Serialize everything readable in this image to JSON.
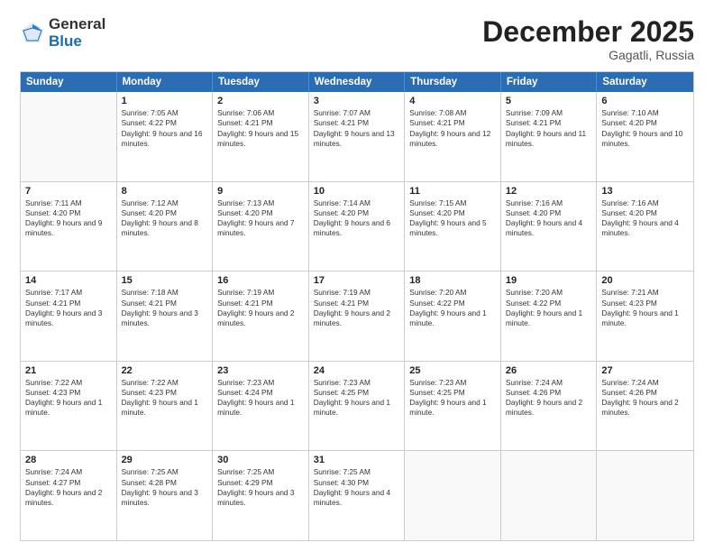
{
  "logo": {
    "general": "General",
    "blue": "Blue"
  },
  "title": "December 2025",
  "location": "Gagatli, Russia",
  "header_days": [
    "Sunday",
    "Monday",
    "Tuesday",
    "Wednesday",
    "Thursday",
    "Friday",
    "Saturday"
  ],
  "weeks": [
    [
      {
        "day": "",
        "sunrise": "",
        "sunset": "",
        "daylight": ""
      },
      {
        "day": "1",
        "sunrise": "Sunrise: 7:05 AM",
        "sunset": "Sunset: 4:22 PM",
        "daylight": "Daylight: 9 hours and 16 minutes."
      },
      {
        "day": "2",
        "sunrise": "Sunrise: 7:06 AM",
        "sunset": "Sunset: 4:21 PM",
        "daylight": "Daylight: 9 hours and 15 minutes."
      },
      {
        "day": "3",
        "sunrise": "Sunrise: 7:07 AM",
        "sunset": "Sunset: 4:21 PM",
        "daylight": "Daylight: 9 hours and 13 minutes."
      },
      {
        "day": "4",
        "sunrise": "Sunrise: 7:08 AM",
        "sunset": "Sunset: 4:21 PM",
        "daylight": "Daylight: 9 hours and 12 minutes."
      },
      {
        "day": "5",
        "sunrise": "Sunrise: 7:09 AM",
        "sunset": "Sunset: 4:21 PM",
        "daylight": "Daylight: 9 hours and 11 minutes."
      },
      {
        "day": "6",
        "sunrise": "Sunrise: 7:10 AM",
        "sunset": "Sunset: 4:20 PM",
        "daylight": "Daylight: 9 hours and 10 minutes."
      }
    ],
    [
      {
        "day": "7",
        "sunrise": "Sunrise: 7:11 AM",
        "sunset": "Sunset: 4:20 PM",
        "daylight": "Daylight: 9 hours and 9 minutes."
      },
      {
        "day": "8",
        "sunrise": "Sunrise: 7:12 AM",
        "sunset": "Sunset: 4:20 PM",
        "daylight": "Daylight: 9 hours and 8 minutes."
      },
      {
        "day": "9",
        "sunrise": "Sunrise: 7:13 AM",
        "sunset": "Sunset: 4:20 PM",
        "daylight": "Daylight: 9 hours and 7 minutes."
      },
      {
        "day": "10",
        "sunrise": "Sunrise: 7:14 AM",
        "sunset": "Sunset: 4:20 PM",
        "daylight": "Daylight: 9 hours and 6 minutes."
      },
      {
        "day": "11",
        "sunrise": "Sunrise: 7:15 AM",
        "sunset": "Sunset: 4:20 PM",
        "daylight": "Daylight: 9 hours and 5 minutes."
      },
      {
        "day": "12",
        "sunrise": "Sunrise: 7:16 AM",
        "sunset": "Sunset: 4:20 PM",
        "daylight": "Daylight: 9 hours and 4 minutes."
      },
      {
        "day": "13",
        "sunrise": "Sunrise: 7:16 AM",
        "sunset": "Sunset: 4:20 PM",
        "daylight": "Daylight: 9 hours and 4 minutes."
      }
    ],
    [
      {
        "day": "14",
        "sunrise": "Sunrise: 7:17 AM",
        "sunset": "Sunset: 4:21 PM",
        "daylight": "Daylight: 9 hours and 3 minutes."
      },
      {
        "day": "15",
        "sunrise": "Sunrise: 7:18 AM",
        "sunset": "Sunset: 4:21 PM",
        "daylight": "Daylight: 9 hours and 3 minutes."
      },
      {
        "day": "16",
        "sunrise": "Sunrise: 7:19 AM",
        "sunset": "Sunset: 4:21 PM",
        "daylight": "Daylight: 9 hours and 2 minutes."
      },
      {
        "day": "17",
        "sunrise": "Sunrise: 7:19 AM",
        "sunset": "Sunset: 4:21 PM",
        "daylight": "Daylight: 9 hours and 2 minutes."
      },
      {
        "day": "18",
        "sunrise": "Sunrise: 7:20 AM",
        "sunset": "Sunset: 4:22 PM",
        "daylight": "Daylight: 9 hours and 1 minute."
      },
      {
        "day": "19",
        "sunrise": "Sunrise: 7:20 AM",
        "sunset": "Sunset: 4:22 PM",
        "daylight": "Daylight: 9 hours and 1 minute."
      },
      {
        "day": "20",
        "sunrise": "Sunrise: 7:21 AM",
        "sunset": "Sunset: 4:23 PM",
        "daylight": "Daylight: 9 hours and 1 minute."
      }
    ],
    [
      {
        "day": "21",
        "sunrise": "Sunrise: 7:22 AM",
        "sunset": "Sunset: 4:23 PM",
        "daylight": "Daylight: 9 hours and 1 minute."
      },
      {
        "day": "22",
        "sunrise": "Sunrise: 7:22 AM",
        "sunset": "Sunset: 4:23 PM",
        "daylight": "Daylight: 9 hours and 1 minute."
      },
      {
        "day": "23",
        "sunrise": "Sunrise: 7:23 AM",
        "sunset": "Sunset: 4:24 PM",
        "daylight": "Daylight: 9 hours and 1 minute."
      },
      {
        "day": "24",
        "sunrise": "Sunrise: 7:23 AM",
        "sunset": "Sunset: 4:25 PM",
        "daylight": "Daylight: 9 hours and 1 minute."
      },
      {
        "day": "25",
        "sunrise": "Sunrise: 7:23 AM",
        "sunset": "Sunset: 4:25 PM",
        "daylight": "Daylight: 9 hours and 1 minute."
      },
      {
        "day": "26",
        "sunrise": "Sunrise: 7:24 AM",
        "sunset": "Sunset: 4:26 PM",
        "daylight": "Daylight: 9 hours and 2 minutes."
      },
      {
        "day": "27",
        "sunrise": "Sunrise: 7:24 AM",
        "sunset": "Sunset: 4:26 PM",
        "daylight": "Daylight: 9 hours and 2 minutes."
      }
    ],
    [
      {
        "day": "28",
        "sunrise": "Sunrise: 7:24 AM",
        "sunset": "Sunset: 4:27 PM",
        "daylight": "Daylight: 9 hours and 2 minutes."
      },
      {
        "day": "29",
        "sunrise": "Sunrise: 7:25 AM",
        "sunset": "Sunset: 4:28 PM",
        "daylight": "Daylight: 9 hours and 3 minutes."
      },
      {
        "day": "30",
        "sunrise": "Sunrise: 7:25 AM",
        "sunset": "Sunset: 4:29 PM",
        "daylight": "Daylight: 9 hours and 3 minutes."
      },
      {
        "day": "31",
        "sunrise": "Sunrise: 7:25 AM",
        "sunset": "Sunset: 4:30 PM",
        "daylight": "Daylight: 9 hours and 4 minutes."
      },
      {
        "day": "",
        "sunrise": "",
        "sunset": "",
        "daylight": ""
      },
      {
        "day": "",
        "sunrise": "",
        "sunset": "",
        "daylight": ""
      },
      {
        "day": "",
        "sunrise": "",
        "sunset": "",
        "daylight": ""
      }
    ]
  ]
}
